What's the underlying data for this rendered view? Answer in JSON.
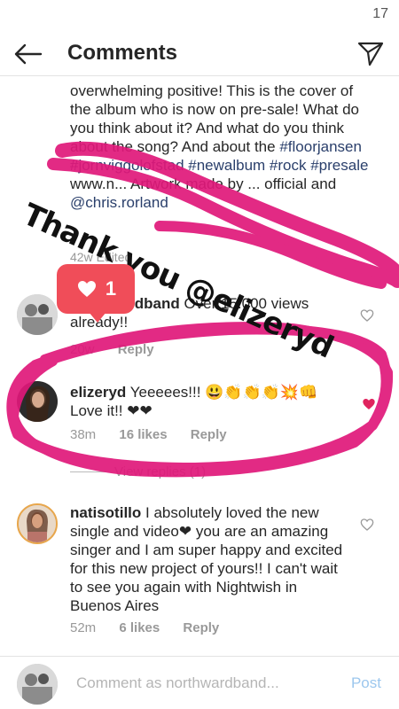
{
  "status": {
    "time": "17"
  },
  "header": {
    "title": "Comments"
  },
  "caption": {
    "text_1": "overwhelming positive! This is the cover of the album who is now on pre-sale! What do you think about it? And what do you think about the song? And about the",
    "tags": "#floorjansen #jornviggolofstad #newalbum #rock #presale",
    "text_2": "www.n... Artwork made by ... official and",
    "mention": "@chris.rorland",
    "meta": "42w  Edited"
  },
  "comments": [
    {
      "username": "northwardband",
      "text": "Over 15.000 views already!!",
      "time": "20w",
      "likes": "",
      "reply": "Reply"
    },
    {
      "username": "elizeryd",
      "text": "Yeeeees!!! 😃👏👏👏💥👊 Love it!! ❤❤",
      "time": "38m",
      "likes": "16 likes",
      "reply": "Reply"
    },
    {
      "username": "natisotillo",
      "text": "I absolutely loved the new single and video❤ you are an amazing singer and I am super happy and excited for this new project of yours!! I can't wait to see you again with Nightwish in Buenos Aires",
      "time": "52m",
      "likes": "6 likes",
      "reply": "Reply"
    }
  ],
  "view_replies": "View replies (1)",
  "composer": {
    "placeholder": "Comment as northwardband...",
    "post_label": "Post"
  },
  "overlay": {
    "sticker_text": "Thank you @elizeryd",
    "like_count": "1"
  },
  "colors": {
    "marker": "#e0187a",
    "like_bubble": "#f04d59",
    "post_button": "#9cc7ee",
    "heart_red": "#e0245e"
  }
}
